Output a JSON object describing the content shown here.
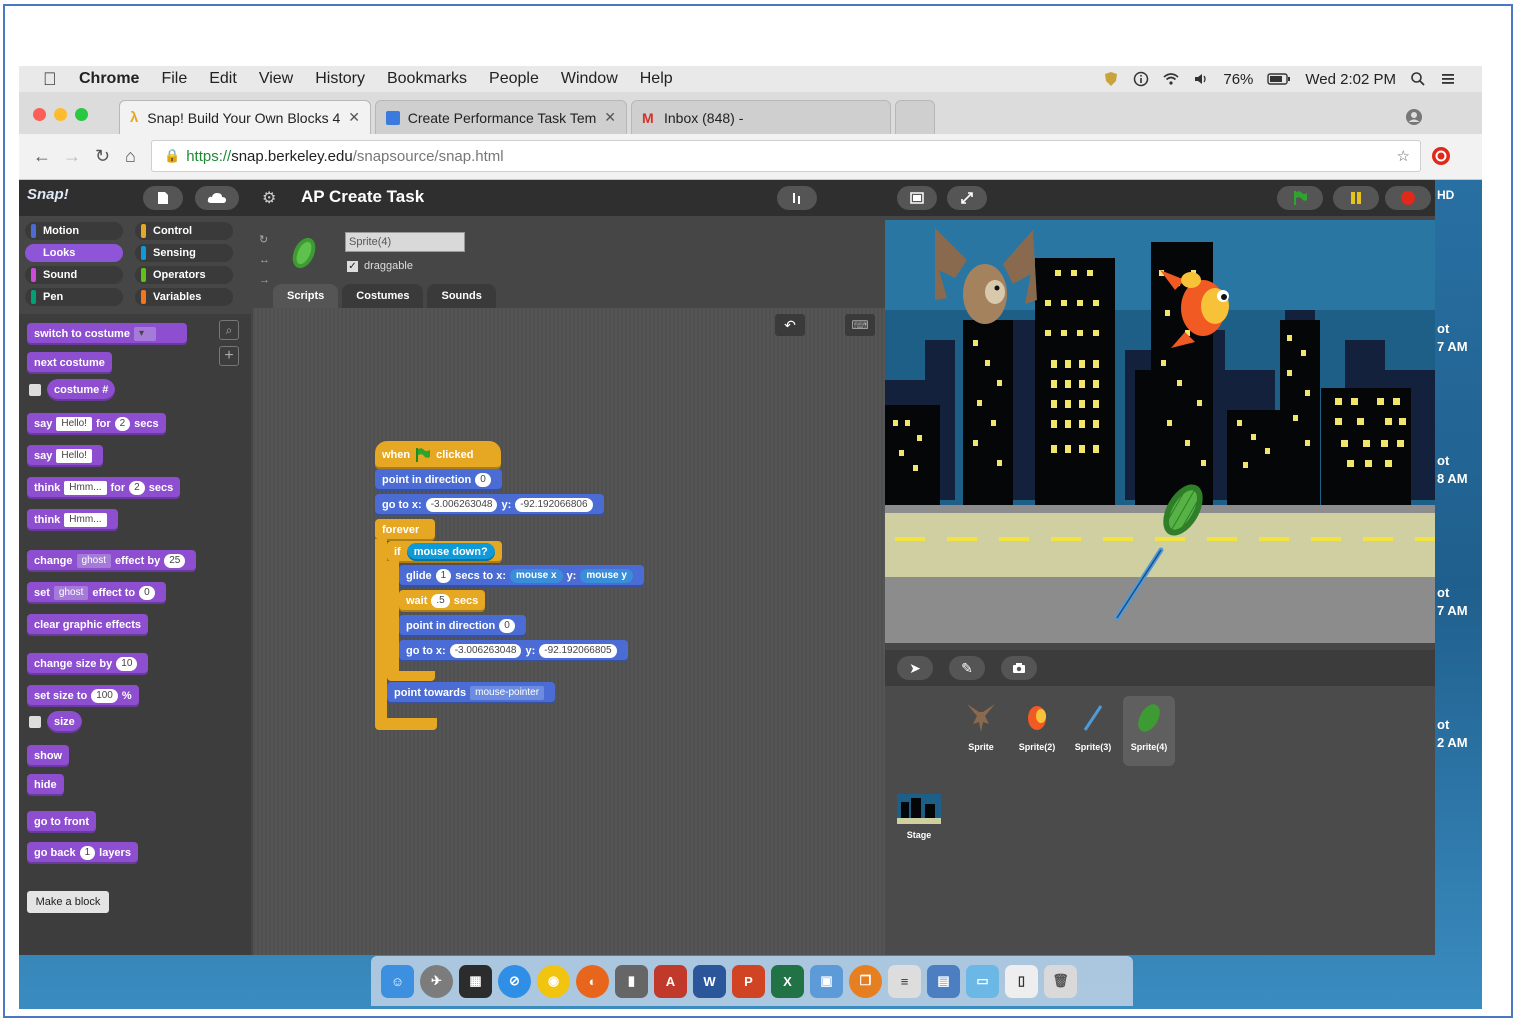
{
  "menubar": {
    "app": "Chrome",
    "items": [
      "File",
      "Edit",
      "View",
      "History",
      "Bookmarks",
      "People",
      "Window",
      "Help"
    ],
    "battery": "76%",
    "clock": "Wed 2:02 PM"
  },
  "browser": {
    "tabs": [
      {
        "label": "Snap! Build Your Own Blocks 4",
        "active": true
      },
      {
        "label": "Create Performance Task Tem",
        "active": false
      },
      {
        "label": "Inbox (848) -",
        "active": false
      }
    ],
    "url_scheme": "https://",
    "url_host": "snap.berkeley.edu",
    "url_path": "/snapsource/snap.html"
  },
  "snap": {
    "logo": "Snap!",
    "project_title": "AP Create Task",
    "categories": [
      {
        "label": "Motion",
        "color": "#4a6cd4"
      },
      {
        "label": "Control",
        "color": "#e6a822"
      },
      {
        "label": "Looks",
        "color": "#8e55d8"
      },
      {
        "label": "Sensing",
        "color": "#0e9ad8"
      },
      {
        "label": "Sound",
        "color": "#cf4ad9"
      },
      {
        "label": "Operators",
        "color": "#62c213"
      },
      {
        "label": "Pen",
        "color": "#00a178"
      },
      {
        "label": "Variables",
        "color": "#f3761d"
      }
    ],
    "palette": {
      "switch_costume": "switch to costume",
      "next_costume": "next costume",
      "costume_num": "costume #",
      "say_for_a": "say",
      "say_for_val": "Hello!",
      "say_for_b": "for",
      "say_for_secs": "2",
      "say_for_c": "secs",
      "say": "say",
      "say_val": "Hello!",
      "think_for_a": "think",
      "think_for_val": "Hmm...",
      "think_for_b": "for",
      "think_for_secs": "2",
      "think_for_c": "secs",
      "think": "think",
      "think_val": "Hmm...",
      "change_effect_a": "change",
      "change_effect_val": "ghost",
      "change_effect_b": "effect by",
      "change_effect_num": "25",
      "set_effect_a": "set",
      "set_effect_val": "ghost",
      "set_effect_b": "effect to",
      "set_effect_num": "0",
      "clear_effects": "clear graphic effects",
      "change_size_a": "change size by",
      "change_size_num": "10",
      "set_size_a": "set size to",
      "set_size_num": "100",
      "set_size_b": "%",
      "size": "size",
      "show": "show",
      "hide": "hide",
      "go_front": "go to front",
      "go_back_a": "go back",
      "go_back_num": "1",
      "go_back_b": "layers",
      "make_block": "Make a block"
    },
    "sprite": {
      "name": "Sprite(4)",
      "draggable": "draggable",
      "tabs": [
        "Scripts",
        "Costumes",
        "Sounds"
      ]
    },
    "script": {
      "hat_a": "when",
      "hat_b": "clicked",
      "point_dir_a": "point in direction",
      "point_dir_val": "0",
      "goto_a": "go to x:",
      "goto_x": "-3.006263048",
      "goto_b": "y:",
      "goto_y": "-92.192066806",
      "forever": "forever",
      "if_a": "if",
      "mouse_down": "mouse down?",
      "glide_a": "glide",
      "glide_secs": "1",
      "glide_b": "secs to x:",
      "mouse_x": "mouse x",
      "glide_c": "y:",
      "mouse_y": "mouse y",
      "wait_a": "wait",
      "wait_val": ".5",
      "wait_b": "secs",
      "point_dir2_a": "point in direction",
      "point_dir2_val": "0",
      "goto2_a": "go to x:",
      "goto2_x": "-3.006263048",
      "goto2_b": "y:",
      "goto2_y": "-92.192066805",
      "point_towards_a": "point towards",
      "point_towards_val": "mouse-pointer"
    },
    "corral": {
      "sprites": [
        "Sprite",
        "Sprite(2)",
        "Sprite(3)",
        "Sprite(4)"
      ],
      "stage": "Stage"
    },
    "hd": "HD"
  },
  "desktop": {
    "peeks": [
      "ot",
      "7 AM",
      "ot",
      "8 AM",
      "ot",
      "7 AM",
      "ot",
      "2 AM"
    ]
  }
}
